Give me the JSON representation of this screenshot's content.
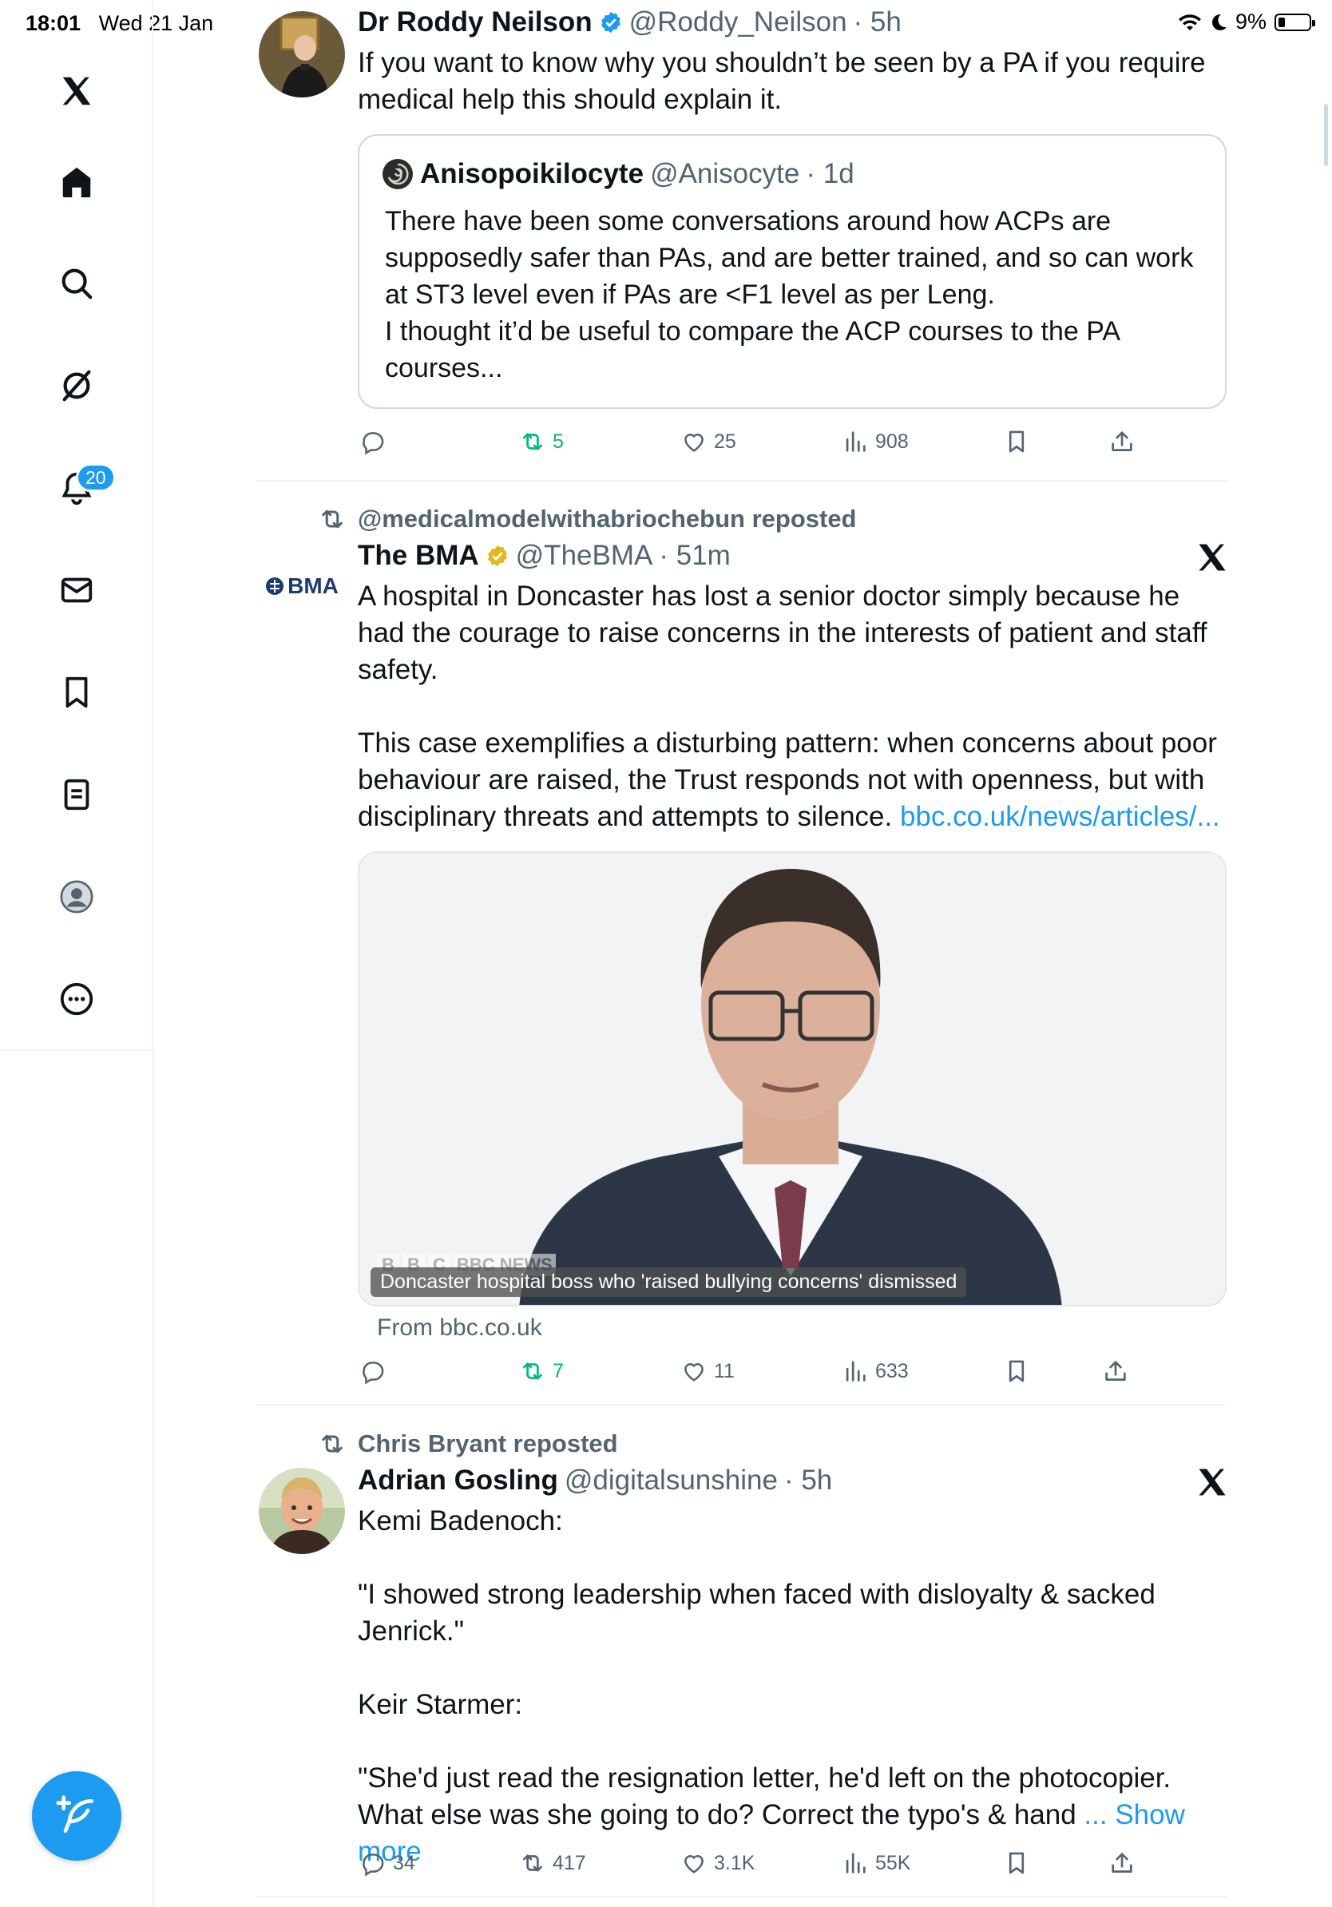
{
  "status_bar": {
    "time": "18:01",
    "date": "Wed 21 Jan",
    "battery": "9%"
  },
  "sidebar": {
    "items": [
      {
        "icon": "x-logo-icon"
      },
      {
        "icon": "home-icon"
      },
      {
        "icon": "search-icon"
      },
      {
        "icon": "grok-icon"
      },
      {
        "icon": "bell-icon",
        "badge": "20"
      },
      {
        "icon": "mail-icon"
      },
      {
        "icon": "bookmark-icon"
      },
      {
        "icon": "lists-icon"
      },
      {
        "icon": "profile-icon"
      },
      {
        "icon": "more-icon"
      }
    ]
  },
  "tweets": [
    {
      "name": "Dr Roddy Neilson",
      "handle": "@Roddy_Neilson",
      "time": "· 5h",
      "text": "If you want to know why you shouldn’t be seen by a PA if you require medical help this should explain it.",
      "quote": {
        "name": "Anisopoikilocyte",
        "handle": "@Anisocyte",
        "time": "· 1d",
        "text": "There have been some conversations around how ACPs are supposedly safer than PAs, and are better trained, and so can work at ST3 level even if PAs are <F1 level as per Leng.\nI thought it’d be useful to compare the ACP courses to the PA courses..."
      },
      "actions": {
        "replies": "",
        "reposts": "5",
        "likes": "25",
        "views": "908"
      }
    },
    {
      "reposted_by": "@medicalmodelwithabriochebun reposted",
      "name": "The BMA",
      "handle": "@TheBMA",
      "time": "· 51m",
      "avatar_text": "BMA",
      "text": "A hospital in Doncaster has lost a senior doctor simply because he had the courage to raise concerns in the interests of patient and staff safety.\n\nThis case exemplifies a disturbing pattern: when concerns about poor behaviour are raised, the Trust responds not with openness, but with disciplinary threats and attempts to silence. ",
      "link": "bbc.co.uk/news/articles/...",
      "media": {
        "caption": "Doncaster hospital boss who 'raised bullying concerns' dismissed",
        "watermark": "BBC NEWS",
        "source": "From bbc.co.uk"
      },
      "actions": {
        "replies": "",
        "reposts": "7",
        "likes": "11",
        "views": "633"
      }
    },
    {
      "reposted_by": "Chris Bryant reposted",
      "name": "Adrian Gosling",
      "handle": "@digitalsunshine",
      "time": "· 5h",
      "text": "Kemi Badenoch:\n\n\"I showed strong leadership when faced with disloyalty & sacked Jenrick.\"\n\nKeir Starmer:\n\n\"She'd just read the resignation letter, he'd left on the photocopier. What else was she going to do? Correct the typo's & hand ",
      "show_more": "... Show more",
      "actions": {
        "replies": "34",
        "reposts": "417",
        "likes": "3.1K",
        "views": "55K"
      }
    }
  ],
  "colors": {
    "accent": "#1d9bf0",
    "verified_blue": "#1d9bf0",
    "gold_badge": "#e2b719",
    "repost_green": "#00ba7c",
    "muted_text": "#536471"
  }
}
